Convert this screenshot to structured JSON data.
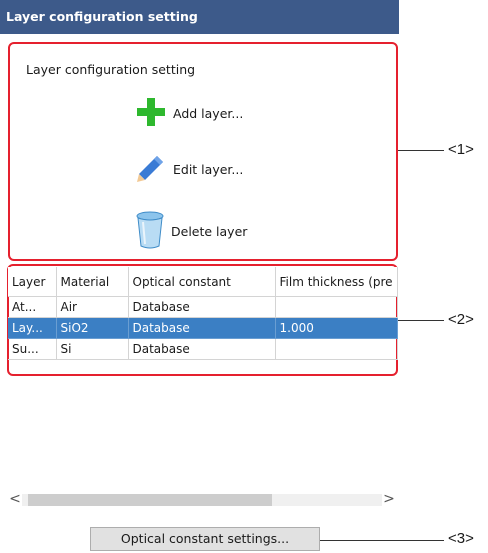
{
  "window": {
    "title": "Layer configuration setting"
  },
  "group": {
    "label": "Layer configuration setting",
    "actions": [
      {
        "label": "Add layer...",
        "icon": "plus-icon",
        "color": "#2eb82e"
      },
      {
        "label": "Edit layer...",
        "icon": "pencil-icon",
        "color": "#3a7bd5"
      },
      {
        "label": "Delete layer",
        "icon": "trash-can-icon",
        "color": "#5aa8e0"
      }
    ]
  },
  "table": {
    "columns": [
      "Layer",
      "Material",
      "Optical constant",
      "Film thickness (pre"
    ],
    "rows": [
      [
        "At...",
        "Air",
        "Database",
        ""
      ],
      [
        "Lay...",
        "SiO2",
        "Database",
        "1.000"
      ],
      [
        "Su...",
        "Si",
        "Database",
        ""
      ]
    ],
    "selected_row_index": 1
  },
  "scroll": {
    "left_arrow": "<",
    "right_arrow": ">"
  },
  "button": {
    "label": "Optical constant settings..."
  },
  "callouts": [
    "<1>",
    "<2>",
    "<3>"
  ],
  "colors": {
    "title_bar": "#3d5a8a",
    "highlight_box": "#e5202e",
    "selection": "#3b7fc4"
  }
}
